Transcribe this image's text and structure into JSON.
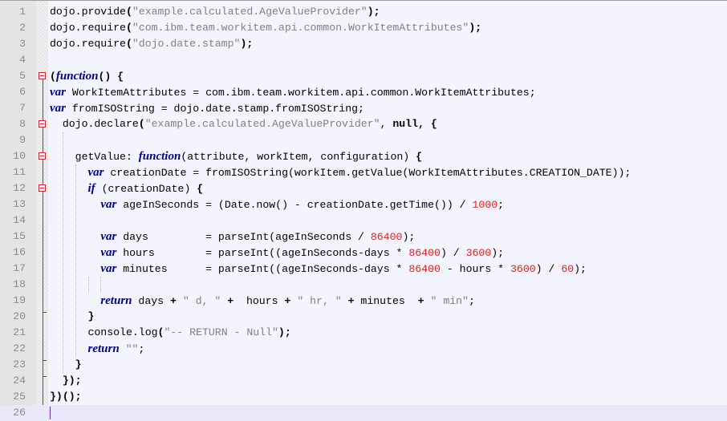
{
  "editor": {
    "language": "javascript",
    "current_line": 26,
    "lines": [
      {
        "n": "1",
        "tokens": [
          [
            "plain",
            "dojo.provide"
          ],
          [
            "op",
            "("
          ],
          [
            "str",
            "\"example.calculated.AgeValueProvider\""
          ],
          [
            "op",
            ");"
          ]
        ]
      },
      {
        "n": "2",
        "tokens": [
          [
            "plain",
            "dojo.require"
          ],
          [
            "op",
            "("
          ],
          [
            "str",
            "\"com.ibm.team.workitem.api.common.WorkItemAttributes\""
          ],
          [
            "op",
            ");"
          ]
        ]
      },
      {
        "n": "3",
        "tokens": [
          [
            "plain",
            "dojo.require"
          ],
          [
            "op",
            "("
          ],
          [
            "str",
            "\"dojo.date.stamp\""
          ],
          [
            "op",
            ");"
          ]
        ]
      },
      {
        "n": "4",
        "tokens": []
      },
      {
        "n": "5",
        "tokens": [
          [
            "op",
            "("
          ],
          [
            "kw",
            "function"
          ],
          [
            "op",
            "() {"
          ]
        ]
      },
      {
        "n": "6",
        "tokens": [
          [
            "kw",
            "var"
          ],
          [
            "plain",
            " WorkItemAttributes = com.ibm.team.workitem.api.common.WorkItemAttributes;"
          ]
        ]
      },
      {
        "n": "7",
        "tokens": [
          [
            "kw",
            "var"
          ],
          [
            "plain",
            " fromISOString = dojo.date.stamp.fromISOString;"
          ]
        ]
      },
      {
        "n": "8",
        "tokens": [
          [
            "plain",
            "  dojo.declare"
          ],
          [
            "op",
            "("
          ],
          [
            "str",
            "\"example.calculated.AgeValueProvider\""
          ],
          [
            "plain",
            ", "
          ],
          [
            "op",
            "null, {"
          ]
        ]
      },
      {
        "n": "9",
        "tokens": []
      },
      {
        "n": "10",
        "tokens": [
          [
            "plain",
            "    getValue: "
          ],
          [
            "kw",
            "function"
          ],
          [
            "plain",
            "(attribute, workItem, configuration) "
          ],
          [
            "op",
            "{"
          ]
        ]
      },
      {
        "n": "11",
        "tokens": [
          [
            "plain",
            "      "
          ],
          [
            "kw",
            "var"
          ],
          [
            "plain",
            " creationDate = fromISOString(workItem.getValue(WorkItemAttributes.CREATION_DATE));"
          ]
        ]
      },
      {
        "n": "12",
        "tokens": [
          [
            "plain",
            "      "
          ],
          [
            "kw",
            "if"
          ],
          [
            "plain",
            " (creationDate) "
          ],
          [
            "op",
            "{"
          ]
        ]
      },
      {
        "n": "13",
        "tokens": [
          [
            "plain",
            "        "
          ],
          [
            "kw",
            "var"
          ],
          [
            "plain",
            " ageInSeconds = (Date.now() - creationDate.getTime()) / "
          ],
          [
            "num",
            "1000"
          ],
          [
            "plain",
            ";"
          ]
        ]
      },
      {
        "n": "14",
        "tokens": []
      },
      {
        "n": "15",
        "tokens": [
          [
            "plain",
            "        "
          ],
          [
            "kw",
            "var"
          ],
          [
            "plain",
            " days         = parseInt(ageInSeconds / "
          ],
          [
            "num",
            "86400"
          ],
          [
            "plain",
            ");"
          ]
        ]
      },
      {
        "n": "16",
        "tokens": [
          [
            "plain",
            "        "
          ],
          [
            "kw",
            "var"
          ],
          [
            "plain",
            " hours        = parseInt((ageInSeconds-days * "
          ],
          [
            "num",
            "86400"
          ],
          [
            "plain",
            ") / "
          ],
          [
            "num",
            "3600"
          ],
          [
            "plain",
            ");"
          ]
        ]
      },
      {
        "n": "17",
        "tokens": [
          [
            "plain",
            "        "
          ],
          [
            "kw",
            "var"
          ],
          [
            "plain",
            " minutes      = parseInt((ageInSeconds-days * "
          ],
          [
            "num",
            "86400"
          ],
          [
            "plain",
            " - hours * "
          ],
          [
            "num",
            "3600"
          ],
          [
            "plain",
            ") / "
          ],
          [
            "num",
            "60"
          ],
          [
            "plain",
            ");"
          ]
        ]
      },
      {
        "n": "18",
        "tokens": []
      },
      {
        "n": "19",
        "tokens": [
          [
            "plain",
            "        "
          ],
          [
            "kw",
            "return"
          ],
          [
            "plain",
            " days "
          ],
          [
            "op",
            "+"
          ],
          [
            "str",
            " \" d, \""
          ],
          [
            "op",
            " +"
          ],
          [
            "plain",
            "  hours "
          ],
          [
            "op",
            "+"
          ],
          [
            "str",
            " \" hr, \""
          ],
          [
            "op",
            " +"
          ],
          [
            "plain",
            " minutes  "
          ],
          [
            "op",
            "+"
          ],
          [
            "str",
            " \" min\""
          ],
          [
            "plain",
            ";"
          ]
        ]
      },
      {
        "n": "20",
        "tokens": [
          [
            "plain",
            "      "
          ],
          [
            "op",
            "}"
          ]
        ]
      },
      {
        "n": "21",
        "tokens": [
          [
            "plain",
            "      console.log"
          ],
          [
            "op",
            "("
          ],
          [
            "str",
            "\"-- RETURN - Null\""
          ],
          [
            "op",
            ");"
          ]
        ]
      },
      {
        "n": "22",
        "tokens": [
          [
            "plain",
            "      "
          ],
          [
            "kw",
            "return"
          ],
          [
            "str",
            " \"\""
          ],
          [
            "plain",
            ";"
          ]
        ]
      },
      {
        "n": "23",
        "tokens": [
          [
            "plain",
            "    "
          ],
          [
            "op",
            "}"
          ]
        ]
      },
      {
        "n": "24",
        "tokens": [
          [
            "plain",
            "  "
          ],
          [
            "op",
            "});"
          ]
        ]
      },
      {
        "n": "25",
        "tokens": [
          [
            "op",
            "})();"
          ]
        ]
      },
      {
        "n": "26",
        "tokens": []
      }
    ]
  },
  "fold_markers": [
    {
      "line": 5,
      "icon": "fold-minus-icon"
    },
    {
      "line": 8,
      "icon": "fold-minus-icon"
    },
    {
      "line": 10,
      "icon": "fold-minus-icon"
    },
    {
      "line": 12,
      "icon": "fold-minus-icon"
    }
  ],
  "colors": {
    "keyword": "#00007d",
    "string": "#808080",
    "number": "#e2231a",
    "fold": "#c9252e",
    "background": "#f3f4fd"
  }
}
